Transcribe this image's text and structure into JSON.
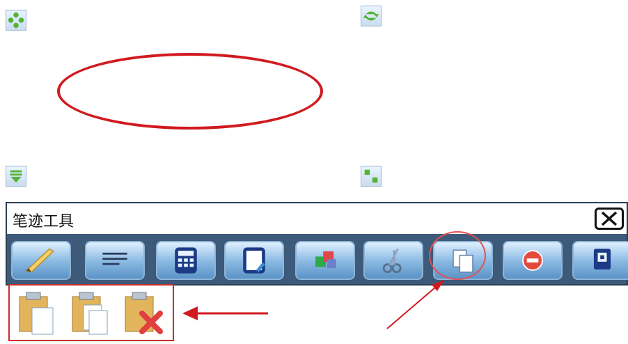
{
  "toolbar": {
    "title": "笔迹工具",
    "buttons": [
      {
        "icon": "pen-icon"
      },
      {
        "icon": "lines-icon"
      },
      {
        "icon": "calculator-icon"
      },
      {
        "icon": "document-edit-icon"
      },
      {
        "icon": "shapes-icon"
      },
      {
        "icon": "scissors-icon"
      },
      {
        "icon": "copy-icon"
      },
      {
        "icon": "delete-icon"
      },
      {
        "icon": "lock-icon"
      }
    ],
    "close_icon": "close-icon"
  },
  "paste_menu": {
    "items": [
      {
        "icon": "paste-icon"
      },
      {
        "icon": "paste-multiple-icon"
      },
      {
        "icon": "paste-cancel-icon"
      }
    ]
  },
  "handles": [
    "move-icon",
    "rotate-icon",
    "down-arrow-icon",
    "resize-icon"
  ],
  "colors": {
    "ellipse_outline": "#d11a20",
    "annotation": "#d11a20",
    "toolbar_bg": "#3d5a7a"
  }
}
